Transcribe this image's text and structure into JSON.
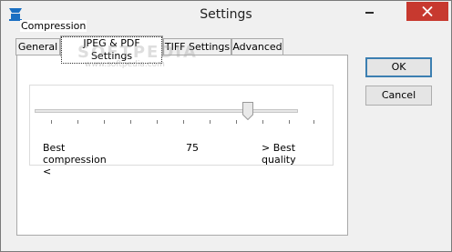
{
  "window": {
    "title": "Settings"
  },
  "tabs": [
    {
      "label": "General",
      "active": false
    },
    {
      "label": "JPEG & PDF Settings",
      "active": true
    },
    {
      "label": "TIFF Settings",
      "active": false
    },
    {
      "label": "Advanced",
      "active": false
    }
  ],
  "compression": {
    "group_label": "Compression",
    "min_label": "Best compression <",
    "value": "75",
    "max_label": "> Best quality",
    "slider_value": 75,
    "slider_min": 0,
    "slider_max": 100
  },
  "buttons": {
    "ok": "OK",
    "cancel": "Cancel"
  },
  "watermark": {
    "main": "SOFTPEDIA",
    "sub": "www.softpedia.com"
  },
  "colors": {
    "close_button": "#c7392f",
    "app_icon": "#1a6fc2",
    "default_button_border": "#3c7fb1"
  }
}
